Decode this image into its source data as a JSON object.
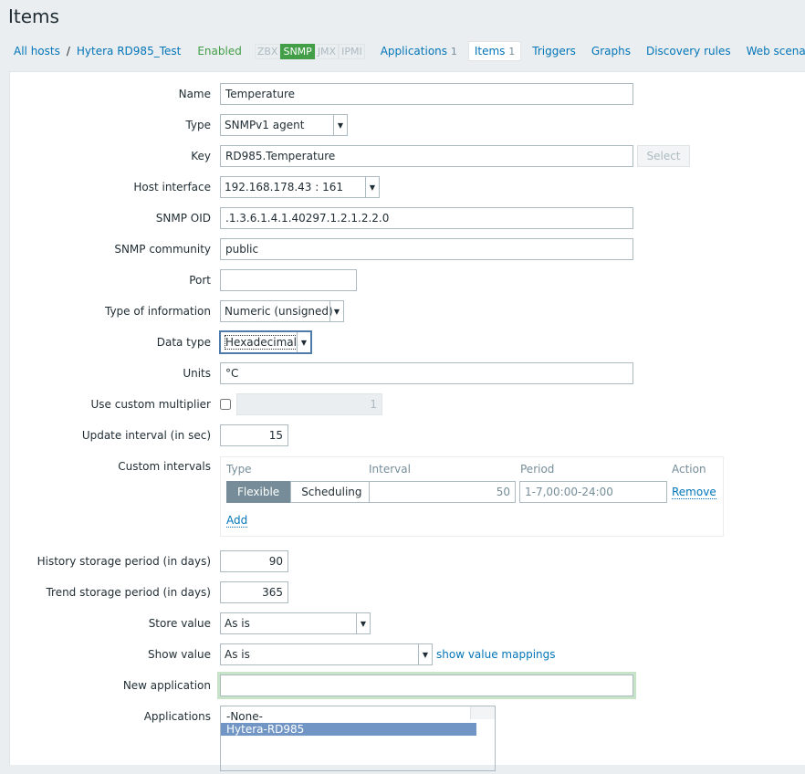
{
  "title": "Items",
  "nav": {
    "all_hosts": "All hosts",
    "host": "Hytera RD985_Test",
    "status": "Enabled",
    "badges": [
      "ZBX",
      "SNMP",
      "JMX",
      "IPMI"
    ],
    "tabs": [
      {
        "label": "Applications",
        "count": "1"
      },
      {
        "label": "Items",
        "count": "1"
      },
      {
        "label": "Triggers"
      },
      {
        "label": "Graphs"
      },
      {
        "label": "Discovery rules"
      },
      {
        "label": "Web scenarios"
      }
    ]
  },
  "form": {
    "name": {
      "label": "Name",
      "value": "Temperature"
    },
    "type": {
      "label": "Type",
      "value": "SNMPv1 agent"
    },
    "key": {
      "label": "Key",
      "value": "RD985.Temperature",
      "button": "Select"
    },
    "host_interface": {
      "label": "Host interface",
      "value": "192.168.178.43 : 161"
    },
    "snmp_oid": {
      "label": "SNMP OID",
      "value": ".1.3.6.1.4.1.40297.1.2.1.2.2.0"
    },
    "snmp_community": {
      "label": "SNMP community",
      "value": "public"
    },
    "port": {
      "label": "Port",
      "value": ""
    },
    "type_info": {
      "label": "Type of information",
      "value": "Numeric (unsigned)"
    },
    "data_type": {
      "label": "Data type",
      "value": "Hexadecimal"
    },
    "units": {
      "label": "Units",
      "value": "°C"
    },
    "multiplier": {
      "label": "Use custom multiplier",
      "value": "1"
    },
    "update": {
      "label": "Update interval (in sec)",
      "value": "15"
    },
    "custom": {
      "label": "Custom intervals",
      "headers": [
        "Type",
        "Interval",
        "Period",
        "Action"
      ],
      "flexible": "Flexible",
      "scheduling": "Scheduling",
      "interval": "50",
      "period": "1-7,00:00-24:00",
      "remove": "Remove",
      "add": "Add"
    },
    "history": {
      "label": "History storage period (in days)",
      "value": "90"
    },
    "trend": {
      "label": "Trend storage period (in days)",
      "value": "365"
    },
    "store": {
      "label": "Store value",
      "value": "As is"
    },
    "show": {
      "label": "Show value",
      "value": "As is",
      "link": "show value mappings"
    },
    "new_app": {
      "label": "New application",
      "value": ""
    },
    "apps": {
      "label": "Applications",
      "items": [
        "-None-",
        "Hytera-RD985"
      ]
    }
  }
}
